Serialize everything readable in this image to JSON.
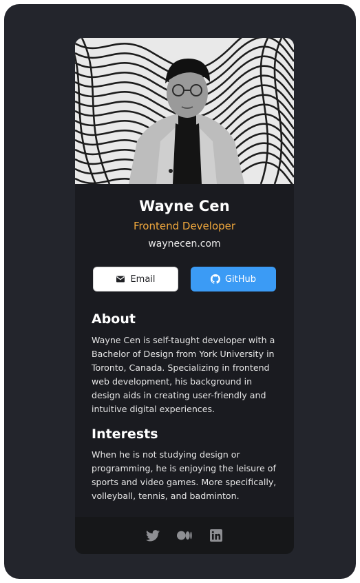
{
  "profile": {
    "name": "Wayne Cen",
    "role": "Frontend Developer",
    "website": "waynecen.com",
    "photo_icon": "profile-photo"
  },
  "actions": {
    "email_label": "Email",
    "email_icon": "envelope-icon",
    "github_label": "GitHub",
    "github_icon": "github-icon"
  },
  "about": {
    "title": "About",
    "body": "Wayne Cen is self-taught developer with a Bachelor of Design from York University in Toronto, Canada. Specializing in frontend web development, his background in design aids in creating user-friendly and intuitive digital experiences."
  },
  "interests": {
    "title": "Interests",
    "body": "When he is not studying design or programming, he is enjoying the leisure of sports and video games. More specifically, volleyball, tennis, and badminton."
  },
  "footer": {
    "icons": [
      "twitter-icon",
      "medium-icon",
      "linkedin-icon"
    ]
  },
  "colors": {
    "frame": "#23252c",
    "card": "#1a1b20",
    "footer": "#161719",
    "accent_role": "#f2a93d",
    "github_button": "#3b9bf5",
    "social_icon": "#8e8f93"
  }
}
